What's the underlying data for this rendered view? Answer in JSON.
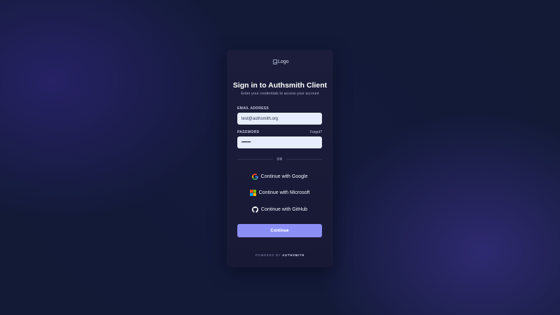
{
  "logo": {
    "alt_text": "Logo",
    "icon": "broken-image-icon"
  },
  "header": {
    "title": "Sign in to Authsmith Client",
    "subtitle": "Enter your credentials to access your account"
  },
  "form": {
    "email_label": "EMAIL ADDRESS",
    "email_value": "test@authsmith.org",
    "password_label": "PASSWORD",
    "password_value": "••••••••",
    "forgot_label": "Forgot?"
  },
  "divider": {
    "label": "OR"
  },
  "social": [
    {
      "label": "Continue with Google",
      "icon": "google-icon"
    },
    {
      "label": "Continue with Microsoft",
      "icon": "microsoft-icon"
    },
    {
      "label": "Continue with GitHub",
      "icon": "github-icon"
    }
  ],
  "continue_label": "Continue",
  "footer": {
    "powered_prefix": "POWERED BY",
    "brand": "AUTHSMITH"
  },
  "colors": {
    "background": "#121a36",
    "card": "#1b1d3a",
    "input": "#e8edfd",
    "accent": "#8b8ff5"
  }
}
